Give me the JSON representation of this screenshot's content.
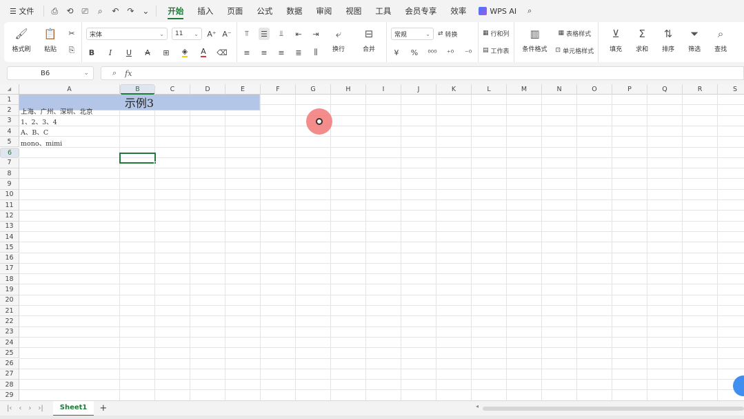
{
  "menubar": {
    "file": "☰ 文件",
    "quick_icons": [
      "⎙",
      "⟲",
      "⎚",
      "⌕",
      "↶",
      "↷",
      "⌄"
    ],
    "tabs": [
      {
        "label": "开始",
        "active": true
      },
      {
        "label": "插入",
        "active": false
      },
      {
        "label": "页面",
        "active": false
      },
      {
        "label": "公式",
        "active": false
      },
      {
        "label": "数据",
        "active": false
      },
      {
        "label": "审阅",
        "active": false
      },
      {
        "label": "视图",
        "active": false
      },
      {
        "label": "工具",
        "active": false
      },
      {
        "label": "会员专享",
        "active": false
      },
      {
        "label": "效率",
        "active": false
      }
    ],
    "ai_label": "WPS AI",
    "accent": "#1e7a38"
  },
  "ribbon": {
    "format_painter": "格式刷",
    "paste": "粘贴",
    "font_name": "宋体",
    "font_size": "11",
    "grow": "A⁺",
    "shrink": "A⁻",
    "bold": "B",
    "italic": "I",
    "underline": "U",
    "strike": "A",
    "wrap": "换行",
    "merge": "合并",
    "number_format": "常规",
    "convert": "转换",
    "rows_cols": "行和列",
    "worksheet": "工作表",
    "cond_format": "条件格式",
    "table_style": "表格样式",
    "cell_style": "单元格样式",
    "fill": "填充",
    "sum": "求和",
    "sort": "排序",
    "filter": "筛选",
    "find": "查找",
    "currency": "¥",
    "percent": "%"
  },
  "formula_bar": {
    "name_box": "B6",
    "fx": "fx"
  },
  "sheet": {
    "columns": [
      "A",
      "B",
      "C",
      "D",
      "E",
      "F",
      "G",
      "H",
      "I",
      "J",
      "K",
      "L",
      "M",
      "N",
      "O",
      "P",
      "Q",
      "R",
      "S"
    ],
    "selected_column": "B",
    "selected_row": "6",
    "rows": [
      "1",
      "2",
      "3",
      "4",
      "5",
      "6",
      "7",
      "8",
      "9",
      "10",
      "11",
      "12",
      "13",
      "14",
      "15",
      "16",
      "17",
      "18",
      "19",
      "20",
      "21",
      "22",
      "23",
      "24",
      "25",
      "26",
      "27",
      "28",
      "29"
    ],
    "title_cell": "示例3",
    "title_fill": "#b4c6e7",
    "cells": [
      {
        "row": "2",
        "text": "上海、广州、深圳、北京"
      },
      {
        "row": "3",
        "text": "1、2、3、4"
      },
      {
        "row": "4",
        "text": "A、B、C"
      },
      {
        "row": "5",
        "text": "mono、mimi"
      }
    ]
  },
  "tabs": {
    "nav": [
      "|‹",
      "‹",
      "›",
      "›|"
    ],
    "sheet_name": "Sheet1",
    "add": "+"
  }
}
